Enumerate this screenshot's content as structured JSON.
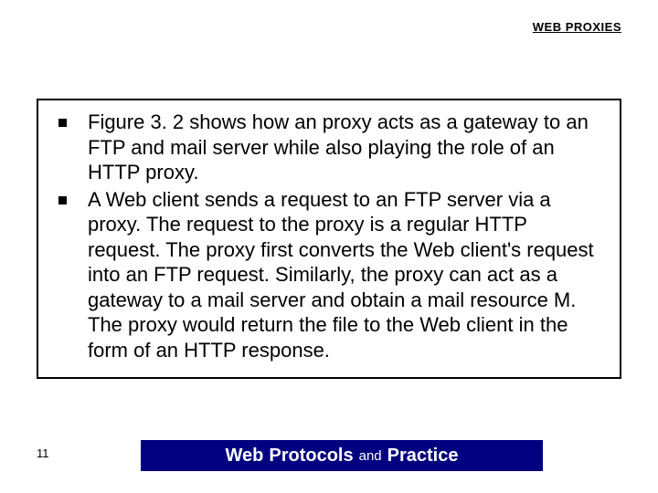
{
  "header": {
    "title": "WEB PROXIES"
  },
  "bullets": [
    "Figure 3. 2 shows how an proxy acts as a gateway to an FTP and mail server while also playing the role of an HTTP proxy.",
    " A Web client sends a request to an FTP server via a proxy. The request to the proxy is a regular HTTP request. The proxy first converts the Web client's request into an FTP request. Similarly, the proxy can act as a gateway to a mail server and obtain a mail resource M. The proxy would return the file to the Web client in the form of an HTTP response."
  ],
  "footer": {
    "page": "11",
    "word1": "Web",
    "word2": "Protocols",
    "word_and": "and",
    "word3": "Practice"
  }
}
